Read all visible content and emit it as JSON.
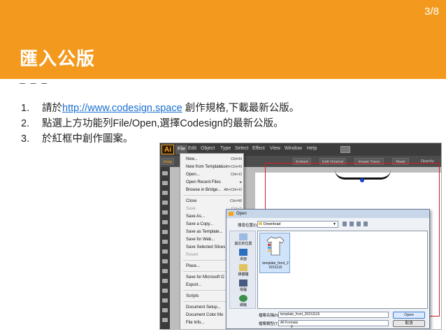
{
  "slide": {
    "page_indicator": "3/8",
    "title": "匯入公版",
    "divider": "– – –",
    "steps": [
      {
        "num": "1.",
        "before": "請於",
        "link": "http://www.codesign.space",
        "after": " 創作規格,下載最新公版。"
      },
      {
        "num": "2.",
        "text": "點選上方功能列File/Open,選擇Codesign的最新公版。"
      },
      {
        "num": "3.",
        "text": "於紅框中創作圖案。"
      }
    ]
  },
  "app": {
    "logo": "Ai",
    "menubar": [
      "File",
      "Edit",
      "Object",
      "Type",
      "Select",
      "Effect",
      "View",
      "Window",
      "Help"
    ],
    "control_bar": [
      "Imag",
      "Embed",
      "Edit Original",
      "Image Trace",
      "Mask",
      "Opacity:"
    ]
  },
  "file_menu": {
    "items": [
      {
        "label": "New...",
        "shortcut": "Ctrl+N"
      },
      {
        "label": "New from Template...",
        "shortcut": "Shift+Ctrl+N"
      },
      {
        "label": "Open...",
        "shortcut": "Ctrl+O"
      },
      {
        "label": "Open Recent Files",
        "shortcut": "▸"
      },
      {
        "label": "Browse in Bridge...",
        "shortcut": "Alt+Ctrl+O"
      },
      {
        "label": "Close",
        "shortcut": "Ctrl+W"
      },
      {
        "label": "Save",
        "shortcut": "Ctrl+S",
        "disabled": true
      },
      {
        "label": "Save As...",
        "shortcut": ""
      },
      {
        "label": "Save a Copy...",
        "shortcut": ""
      },
      {
        "label": "Save as Template...",
        "shortcut": ""
      },
      {
        "label": "Save for Web...",
        "shortcut": ""
      },
      {
        "label": "Save Selected Slices",
        "shortcut": ""
      },
      {
        "label": "Revert",
        "shortcut": "",
        "disabled": true
      },
      {
        "label": "Place...",
        "shortcut": ""
      },
      {
        "label": "Save for Microsoft O",
        "shortcut": ""
      },
      {
        "label": "Export...",
        "shortcut": ""
      },
      {
        "label": "Scripts",
        "shortcut": ""
      },
      {
        "label": "Document Setup...",
        "shortcut": ""
      },
      {
        "label": "Document Color Mo",
        "shortcut": ""
      },
      {
        "label": "File Info...",
        "shortcut": ""
      }
    ]
  },
  "open_dialog": {
    "title": "Open",
    "look_in_label": "搜尋位置(I):",
    "look_in_value": "Download",
    "places": [
      "最近的位置",
      "桌面",
      "媒體櫃",
      "電腦",
      "網路"
    ],
    "file_name_line1": "template_front_2",
    "file_name_line2": "0151116",
    "filename_label": "檔案名稱(N):",
    "filename_value": "template_front_20151116",
    "filetype_label": "檔案類型(T):",
    "filetype_value": "All Formats",
    "open_button": "Open",
    "cancel_button": "取消",
    "bottom_mark": "8"
  },
  "colors": {
    "header_orange": "#f39a1e",
    "link_blue": "#1a6fd0",
    "artboard_red": "#d02020",
    "ai_orange": "#f7a31d"
  }
}
